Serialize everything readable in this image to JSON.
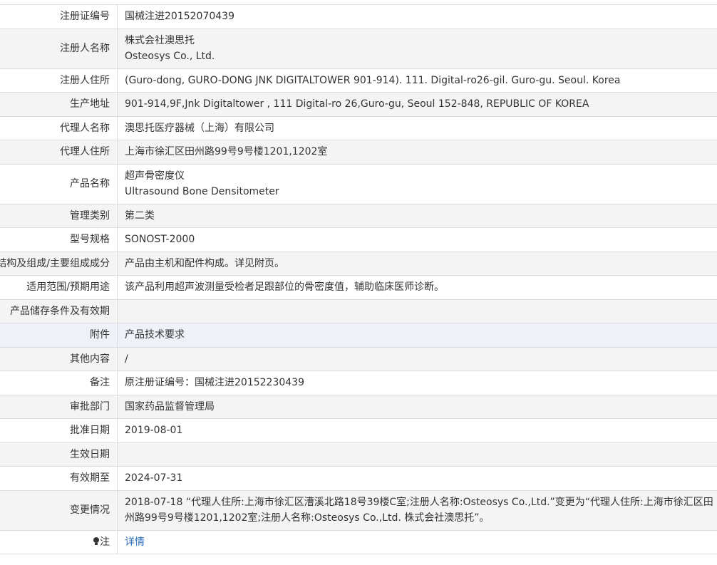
{
  "rows": [
    {
      "label": "注册证编号",
      "value": "国械注进20152070439"
    },
    {
      "label": "注册人名称",
      "value": "株式会社澳思托",
      "value2": "Osteosys Co., Ltd."
    },
    {
      "label": "注册人住所",
      "value": "(Guro-dong, GURO-DONG JNK DIGITALTOWER 901-914). 111. Digital-ro26-gil. Guro-gu. Seoul. Korea"
    },
    {
      "label": "生产地址",
      "value": "901-914,9F,Jnk Digitaltower , 111 Digital-ro 26,Guro-gu, Seoul 152-848, REPUBLIC OF KOREA"
    },
    {
      "label": "代理人名称",
      "value": "澳思托医疗器械（上海）有限公司"
    },
    {
      "label": "代理人住所",
      "value": "上海市徐汇区田州路99号9号楼1201,1202室"
    },
    {
      "label": "产品名称",
      "value": "超声骨密度仪",
      "value2": "Ultrasound Bone Densitometer"
    },
    {
      "label": "管理类别",
      "value": "第二类"
    },
    {
      "label": "型号规格",
      "value": "SONOST-2000"
    },
    {
      "label": "结构及组成/主要组成成分",
      "value": "产品由主机和配件构成。详见附页。"
    },
    {
      "label": "适用范围/预期用途",
      "value": "该产品利用超声波测量受检者足跟部位的骨密度值，辅助临床医师诊断。"
    },
    {
      "label": "产品储存条件及有效期",
      "value": ""
    },
    {
      "label": "附件",
      "value": "产品技术要求"
    },
    {
      "label": "其他内容",
      "value": "/"
    },
    {
      "label": "备注",
      "value": "原注册证编号：国械注进20152230439"
    },
    {
      "label": "审批部门",
      "value": "国家药品监督管理局"
    },
    {
      "label": "批准日期",
      "value": "2019-08-01"
    },
    {
      "label": "生效日期",
      "value": ""
    },
    {
      "label": "有效期至",
      "value": "2024-07-31"
    },
    {
      "label": "变更情况",
      "value": "2018-07-18 “代理人住所:上海市徐汇区漕溪北路18号39楼C室;注册人名称:Osteosys Co.,Ltd.”变更为“代理人住所:上海市徐汇区田州路99号9号楼1201,1202室;注册人名称:Osteosys Co.,Ltd. 株式会社澳思托”。"
    },
    {
      "label": "注",
      "icon": "lightbulb-icon",
      "value": "详情"
    }
  ]
}
